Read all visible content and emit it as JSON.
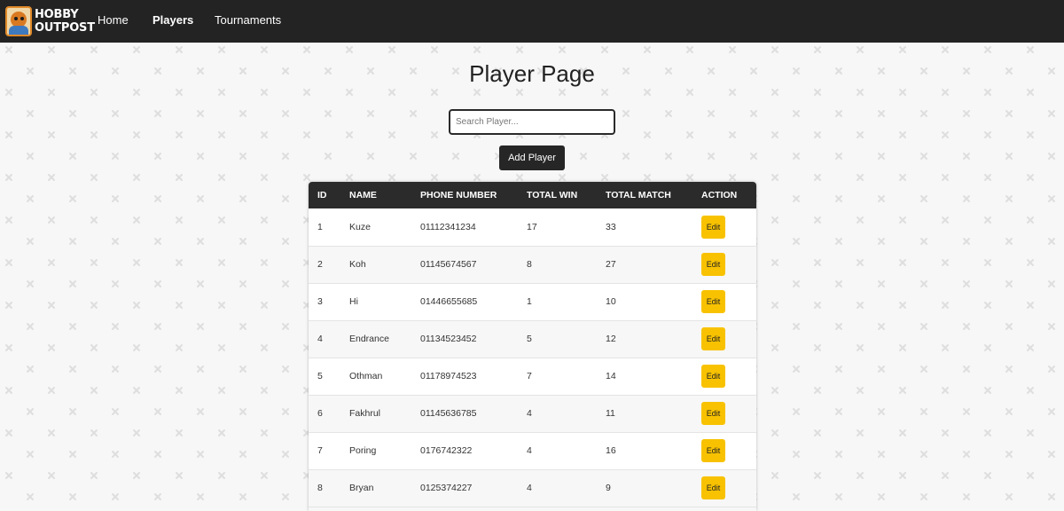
{
  "navbar": {
    "logo_line1": "HOBBY",
    "logo_line2": "OUTPOST",
    "links": [
      {
        "label": "Home",
        "active": false
      },
      {
        "label": "Players",
        "active": true
      },
      {
        "label": "Tournaments",
        "active": false
      }
    ]
  },
  "main": {
    "title": "Player Page",
    "search_placeholder": "Search Player...",
    "search_value": "",
    "add_button_label": "Add Player"
  },
  "table": {
    "headers": [
      "ID",
      "NAME",
      "PHONE NUMBER",
      "TOTAL WIN",
      "TOTAL MATCH",
      "ACTION"
    ],
    "edit_label": "Edit",
    "rows": [
      {
        "id": "1",
        "name": "Kuze",
        "phone": "01112341234",
        "wins": "17",
        "matches": "33"
      },
      {
        "id": "2",
        "name": "Koh",
        "phone": "01145674567",
        "wins": "8",
        "matches": "27"
      },
      {
        "id": "3",
        "name": "Hi",
        "phone": "01446655685",
        "wins": "1",
        "matches": "10"
      },
      {
        "id": "4",
        "name": "Endrance",
        "phone": "01134523452",
        "wins": "5",
        "matches": "12"
      },
      {
        "id": "5",
        "name": "Othman",
        "phone": "01178974523",
        "wins": "7",
        "matches": "14"
      },
      {
        "id": "6",
        "name": "Fakhrul",
        "phone": "01145636785",
        "wins": "4",
        "matches": "11"
      },
      {
        "id": "7",
        "name": "Poring",
        "phone": "0176742322",
        "wins": "4",
        "matches": "16"
      },
      {
        "id": "8",
        "name": "Bryan",
        "phone": "0125374227",
        "wins": "4",
        "matches": "9"
      }
    ]
  },
  "colors": {
    "navbar": "#232323",
    "table_header": "#2b2b2b",
    "edit_button": "#f8c200",
    "background": "#f7f7f7"
  }
}
